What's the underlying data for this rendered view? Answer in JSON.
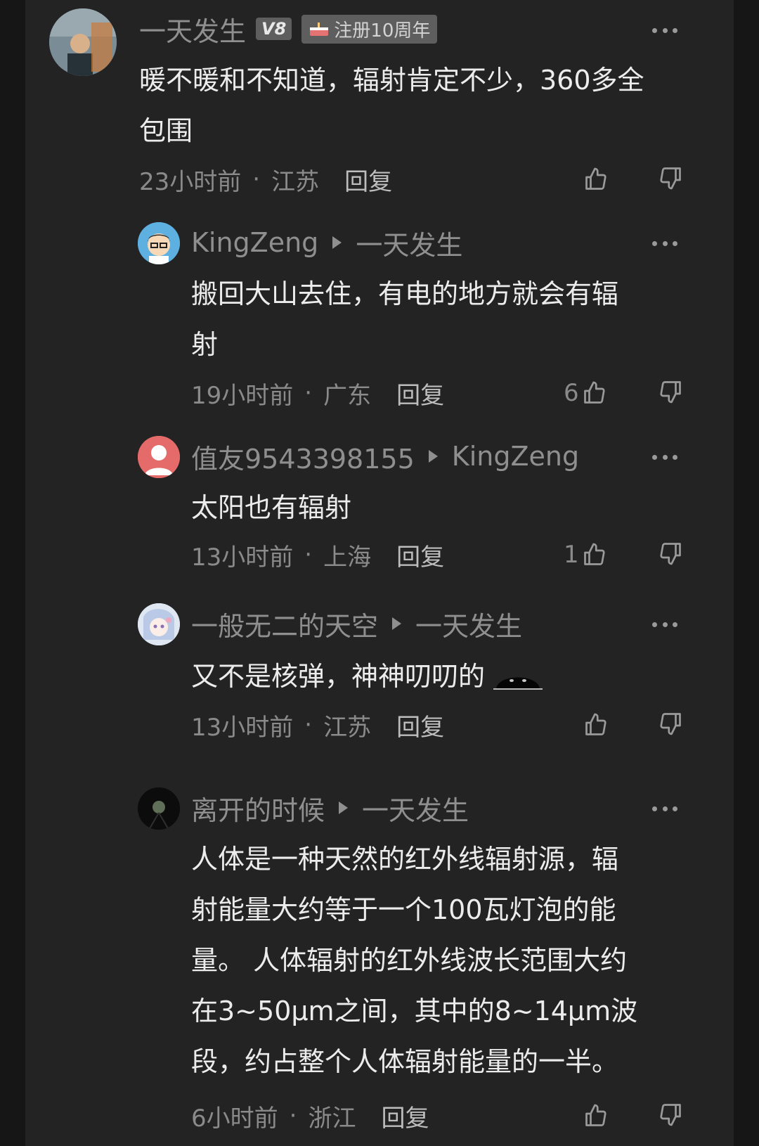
{
  "comments": [
    {
      "username": "一天发生",
      "level_badge": "V8",
      "anniv_badge": "注册10周年",
      "text_lines": [
        "暖不暖和不知道，辐射肯定不少，360多全",
        "包围"
      ],
      "time": "23小时前",
      "region": "江苏",
      "reply_label": "回复",
      "likes": ""
    },
    {
      "username": "KingZeng",
      "reply_to": "一天发生",
      "text_lines": [
        "搬回大山去住，有电的地方就会有辐",
        "射"
      ],
      "time": "19小时前",
      "region": "广东",
      "reply_label": "回复",
      "likes": "6"
    },
    {
      "username": "值友9543398155",
      "reply_to": "KingZeng",
      "text_lines": [
        "太阳也有辐射"
      ],
      "time": "13小时前",
      "region": "上海",
      "reply_label": "回复",
      "likes": "1"
    },
    {
      "username": "一般无二的天空",
      "reply_to": "一天发生",
      "text_lines": [
        "又不是核弹，神神叨叨的"
      ],
      "emoji": "sunglasses-emoji",
      "time": "13小时前",
      "region": "江苏",
      "reply_label": "回复",
      "likes": ""
    },
    {
      "username": "离开的时候",
      "reply_to": "一天发生",
      "text_lines": [
        "人体是一种天然的红外线辐射源，辐",
        "射能量大约等于一个100瓦灯泡的能",
        "量。 人体辐射的红外线波长范围大约",
        "在3~50μm之间，其中的8~14μm波",
        "段，约占整个人体辐射能量的一半。"
      ],
      "time": "6小时前",
      "region": "浙江",
      "reply_label": "回复",
      "likes": ""
    }
  ],
  "separator": "·",
  "colors": {
    "background": "#232323",
    "text": "#ececec",
    "muted": "#8f8f8f"
  }
}
